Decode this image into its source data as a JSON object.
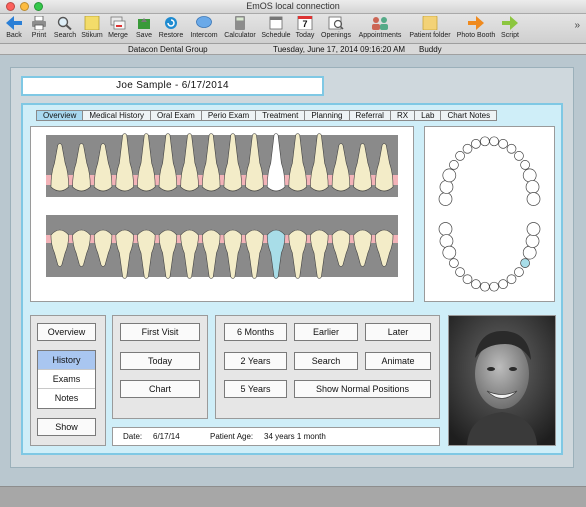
{
  "window": {
    "title": "EmOS local connection"
  },
  "toolbar": {
    "items": [
      {
        "label": "Back",
        "icon": "back-arrow-icon"
      },
      {
        "label": "Print",
        "icon": "printer-icon"
      },
      {
        "label": "Search",
        "icon": "magnifier-icon"
      },
      {
        "label": "Stikum",
        "icon": "sticky-note-icon"
      },
      {
        "label": "Merge",
        "icon": "merge-icon"
      },
      {
        "label": "Save",
        "icon": "save-icon"
      },
      {
        "label": "Restore",
        "icon": "restore-icon"
      },
      {
        "label": "Intercom",
        "icon": "speech-bubble-icon"
      },
      {
        "label": "Calculator",
        "icon": "calculator-icon"
      },
      {
        "label": "Schedule",
        "icon": "schedule-icon"
      },
      {
        "label": "Today",
        "icon": "calendar-icon"
      },
      {
        "label": "Openings",
        "icon": "openings-icon"
      },
      {
        "label": "Appointments",
        "icon": "people-icon"
      },
      {
        "label": "Patient folder",
        "icon": "folder-icon"
      },
      {
        "label": "Photo Booth",
        "icon": "photo-booth-arrow-icon"
      },
      {
        "label": "Script",
        "icon": "script-arrow-icon"
      }
    ],
    "today_day": "7"
  },
  "status": {
    "practice": "Datacon Dental Group",
    "datetime": "Tuesday, June 17, 2014  09:16:20 AM",
    "user": "Buddy"
  },
  "patient": {
    "header": "Joe Sample -  6/17/2014"
  },
  "tabs": [
    "Overview",
    "Medical History",
    "Oral Exam",
    "Perio Exam",
    "Treatment",
    "Planning",
    "Referral",
    "RX",
    "Lab",
    "Chart Notes"
  ],
  "active_tab": "Overview",
  "left_panel": {
    "overview": "Overview",
    "segments": [
      "History",
      "Exams",
      "Notes"
    ],
    "selected_segment": "History",
    "show": "Show"
  },
  "middle_panel": {
    "first_visit": "First Visit",
    "today": "Today",
    "chart": "Chart"
  },
  "right_panel": {
    "six_months": "6 Months",
    "earlier": "Earlier",
    "later": "Later",
    "two_years": "2 Years",
    "search": "Search",
    "animate": "Animate",
    "five_years": "5 Years",
    "show_normal": "Show Normal Positions"
  },
  "info": {
    "date_label": "Date:",
    "date_value": "6/17/14",
    "age_label": "Patient Age:",
    "age_value": "34 years 1 month"
  },
  "colors": {
    "accent": "#7fc8e4",
    "panel_bg": "#cfeef8",
    "selected": "#a9c6f0",
    "gum": "#f3b3b8",
    "tooth": "#f3ecc8",
    "highlight_tooth": "#a8dde8"
  }
}
